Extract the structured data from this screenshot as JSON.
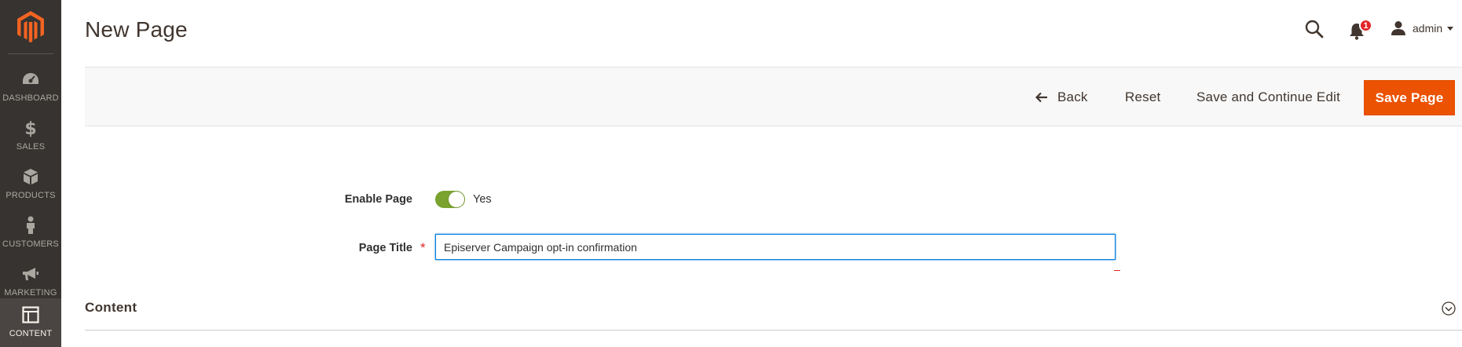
{
  "sidebar": {
    "logo": "magento-logo-icon",
    "items": [
      {
        "label": "DASHBOARD",
        "icon": "dashboard-gauge-icon",
        "active": false
      },
      {
        "label": "SALES",
        "icon": "dollar-icon",
        "active": false
      },
      {
        "label": "PRODUCTS",
        "icon": "box-icon",
        "active": false
      },
      {
        "label": "CUSTOMERS",
        "icon": "person-icon",
        "active": false
      },
      {
        "label": "MARKETING",
        "icon": "megaphone-icon",
        "active": false
      },
      {
        "label": "CONTENT",
        "icon": "layout-icon",
        "active": true
      }
    ]
  },
  "header": {
    "title": "New Page",
    "notifications_count": "1",
    "user_name": "admin"
  },
  "actions": {
    "back_label": "Back",
    "reset_label": "Reset",
    "save_continue_label": "Save and Continue Edit",
    "save_label": "Save Page"
  },
  "form": {
    "enable_label": "Enable Page",
    "enable_value_label": "Yes",
    "enable_on": true,
    "title_label": "Page Title",
    "required_mark": "*",
    "title_value": "Episerver Campaign opt-in confirmation"
  },
  "sections": {
    "content_title": "Content"
  },
  "colors": {
    "sidebar_bg": "#373330",
    "accent": "#eb5202",
    "toggle_on": "#79a22e",
    "badge": "#e22626",
    "focus": "#007bdb"
  }
}
